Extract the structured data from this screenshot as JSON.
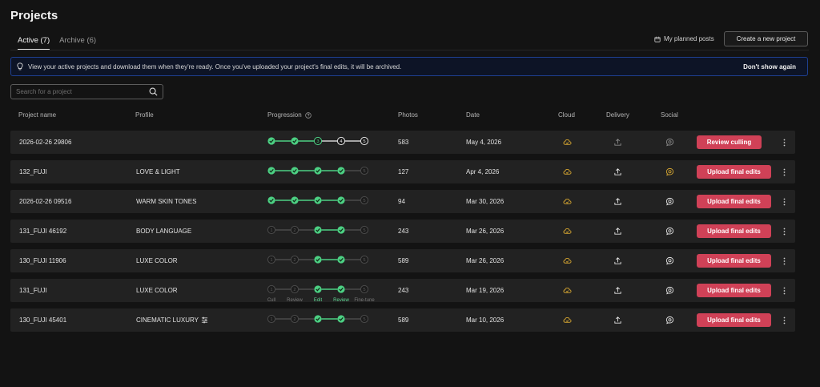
{
  "page": {
    "title": "Projects"
  },
  "tabs": [
    {
      "label": "Active (7)",
      "active": true
    },
    {
      "label": "Archive (6)",
      "active": false
    }
  ],
  "header_actions": {
    "planned_posts": "My planned posts",
    "create_project": "Create a new project"
  },
  "banner": {
    "message": "View your active projects and download them when they're ready. Once you've uploaded your project's final edits, it will be archived.",
    "dismiss": "Don't show again"
  },
  "search": {
    "placeholder": "Search for a project",
    "value": ""
  },
  "columns": {
    "name": "Project name",
    "profile": "Profile",
    "progression": "Progression",
    "photos": "Photos",
    "date": "Date",
    "cloud": "Cloud",
    "delivery": "Delivery",
    "social": "Social"
  },
  "stage_labels": [
    "Cull",
    "Review",
    "Edit",
    "Review",
    "Fine-tune"
  ],
  "colors": {
    "accent_green": "#4cd083",
    "action_red": "#d04157",
    "cloud_gold": "#d3a431",
    "banner_border": "#1e3f8f"
  },
  "projects": [
    {
      "name": "2026-02-26 29806",
      "profile": "",
      "profile_icon": false,
      "steps": [
        "done",
        "done",
        "current",
        "pending",
        "pending"
      ],
      "photos": "583",
      "date": "May 4, 2026",
      "delivery_dim": true,
      "social_state": "dim",
      "action": "Review culling"
    },
    {
      "name": "132_FUJI",
      "profile": "LOVE & LIGHT",
      "profile_icon": false,
      "steps": [
        "done",
        "done",
        "done",
        "done",
        "todo"
      ],
      "photos": "127",
      "date": "Apr 4, 2026",
      "delivery_dim": false,
      "social_state": "gold",
      "action": "Upload final edits"
    },
    {
      "name": "2026-02-26 09516",
      "profile": "WARM SKIN TONES",
      "profile_icon": false,
      "steps": [
        "done",
        "done",
        "done",
        "done",
        "todo"
      ],
      "photos": "94",
      "date": "Mar 30, 2026",
      "delivery_dim": false,
      "social_state": "white",
      "action": "Upload final edits"
    },
    {
      "name": "131_FUJI 46192",
      "profile": "BODY LANGUAGE",
      "profile_icon": false,
      "steps": [
        "skip",
        "skip",
        "done",
        "done",
        "todo"
      ],
      "photos": "243",
      "date": "Mar 26, 2026",
      "delivery_dim": false,
      "social_state": "white",
      "action": "Upload final edits"
    },
    {
      "name": "130_FUJI 11906",
      "profile": "LUXE COLOR",
      "profile_icon": false,
      "steps": [
        "skip",
        "skip",
        "done",
        "done",
        "todo"
      ],
      "photos": "589",
      "date": "Mar 26, 2026",
      "delivery_dim": false,
      "social_state": "white",
      "action": "Upload final edits"
    },
    {
      "name": "131_FUJI",
      "profile": "LUXE COLOR",
      "profile_icon": false,
      "steps": [
        "skip",
        "skip",
        "done",
        "done",
        "todo"
      ],
      "photos": "243",
      "date": "Mar 19, 2026",
      "delivery_dim": false,
      "social_state": "white",
      "action": "Upload final edits",
      "show_labels": true
    },
    {
      "name": "130_FUJI 45401",
      "profile": "CINEMATIC LUXURY",
      "profile_icon": true,
      "steps": [
        "skip",
        "skip",
        "done",
        "done",
        "todo"
      ],
      "photos": "589",
      "date": "Mar 10, 2026",
      "delivery_dim": false,
      "social_state": "white",
      "action": "Upload final edits"
    }
  ]
}
